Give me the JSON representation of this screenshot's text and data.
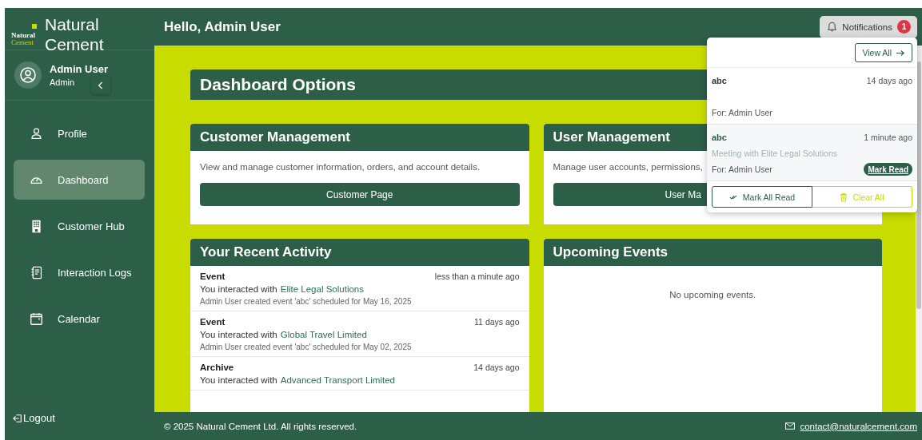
{
  "brand": {
    "logo_top": "Natural",
    "logo_bottom": "Cement",
    "name_line1": "Natural",
    "name_line2": "Cement"
  },
  "user": {
    "name": "Admin User",
    "role": "Admin"
  },
  "sidebar": {
    "items": [
      {
        "label": "Profile",
        "selected": false
      },
      {
        "label": "Dashboard",
        "selected": true
      },
      {
        "label": "Customer Hub",
        "selected": false
      },
      {
        "label": "Interaction Logs",
        "selected": false
      },
      {
        "label": "Calendar",
        "selected": false
      }
    ],
    "logout": "Logout"
  },
  "header": {
    "greeting": "Hello, Admin User",
    "notifications_button": "Notifications",
    "badge": "1"
  },
  "dashboard_title": "Dashboard Options",
  "cards": [
    {
      "title": "Customer Management",
      "description": "View and manage customer information, orders, and account details.",
      "button": "Customer Page"
    },
    {
      "title": "User Management",
      "description": "Manage user accounts, permissions,",
      "button": "User Ma"
    }
  ],
  "recent_activity": {
    "title": "Your Recent Activity",
    "items": [
      {
        "type": "Event",
        "time": "less than a minute ago",
        "prefix": "You interacted with",
        "company": "Elite Legal Solutions",
        "detail": "Admin User created event 'abc' scheduled for May 16, 2025"
      },
      {
        "type": "Event",
        "time": "11 days ago",
        "prefix": "You interacted with",
        "company": "Global Travel Limited",
        "detail": "Admin User created event 'abc' scheduled for May 02, 2025"
      },
      {
        "type": "Archive",
        "time": "14 days ago",
        "prefix": "You interacted with",
        "company": "Advanced Transport Limited"
      }
    ]
  },
  "upcoming_events": {
    "title": "Upcoming Events",
    "empty": "No upcoming events."
  },
  "notifications_panel": {
    "view_all": "View All",
    "items": [
      {
        "title": "abc",
        "time": "14 days ago",
        "for": "For: Admin User",
        "read": true
      },
      {
        "title": "abc",
        "time": "1 minute ago",
        "message": "Meeting with Elite Legal Solutions",
        "for": "For: Admin User",
        "read": false,
        "action": "Mark Read"
      }
    ],
    "mark_all_read": "Mark All Read",
    "clear_all": "Clear All"
  },
  "footer": {
    "copyright": "© 2025 Natural Cement Ltd. All rights reserved.",
    "email": "contact@naturalcement.com"
  }
}
